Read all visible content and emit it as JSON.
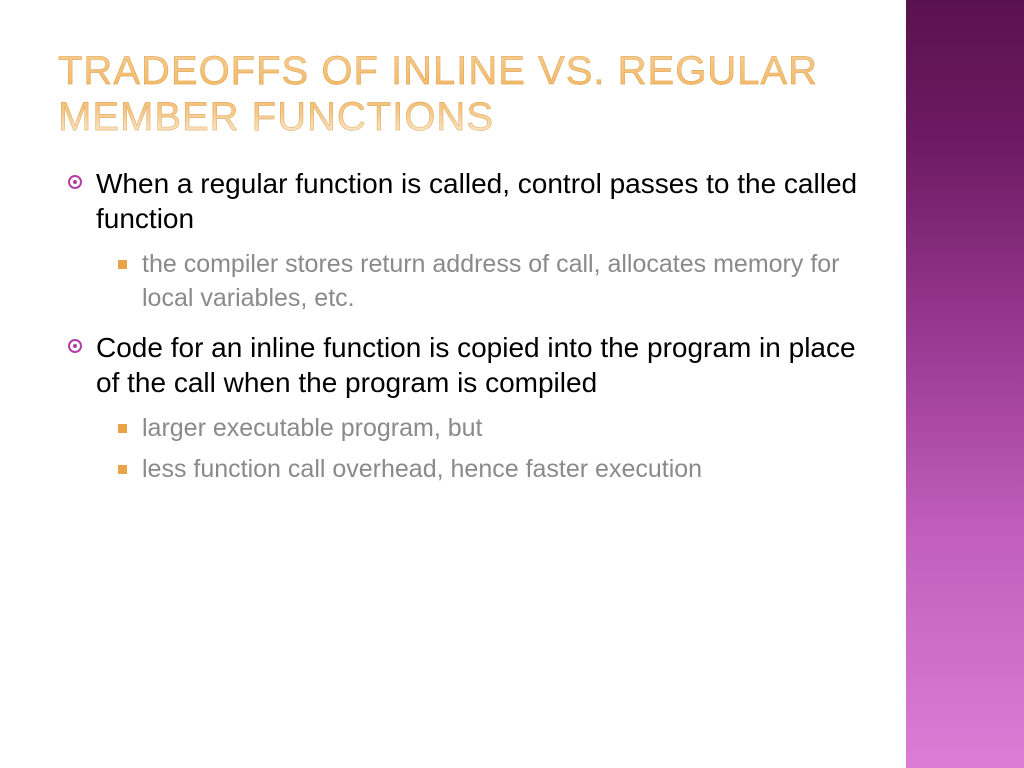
{
  "title": "Tradeoffs of Inline vs. Regular Member Functions",
  "bullets": [
    {
      "text": "When a regular function is called, control passes to the called function",
      "sub": [
        "the compiler stores return address of call, allocates memory for local variables, etc."
      ]
    },
    {
      "text": "Code for an inline function is copied into the program in place of the call when the program is compiled",
      "sub": [
        "larger executable program, but",
        "less function call overhead, hence faster execution"
      ]
    }
  ]
}
